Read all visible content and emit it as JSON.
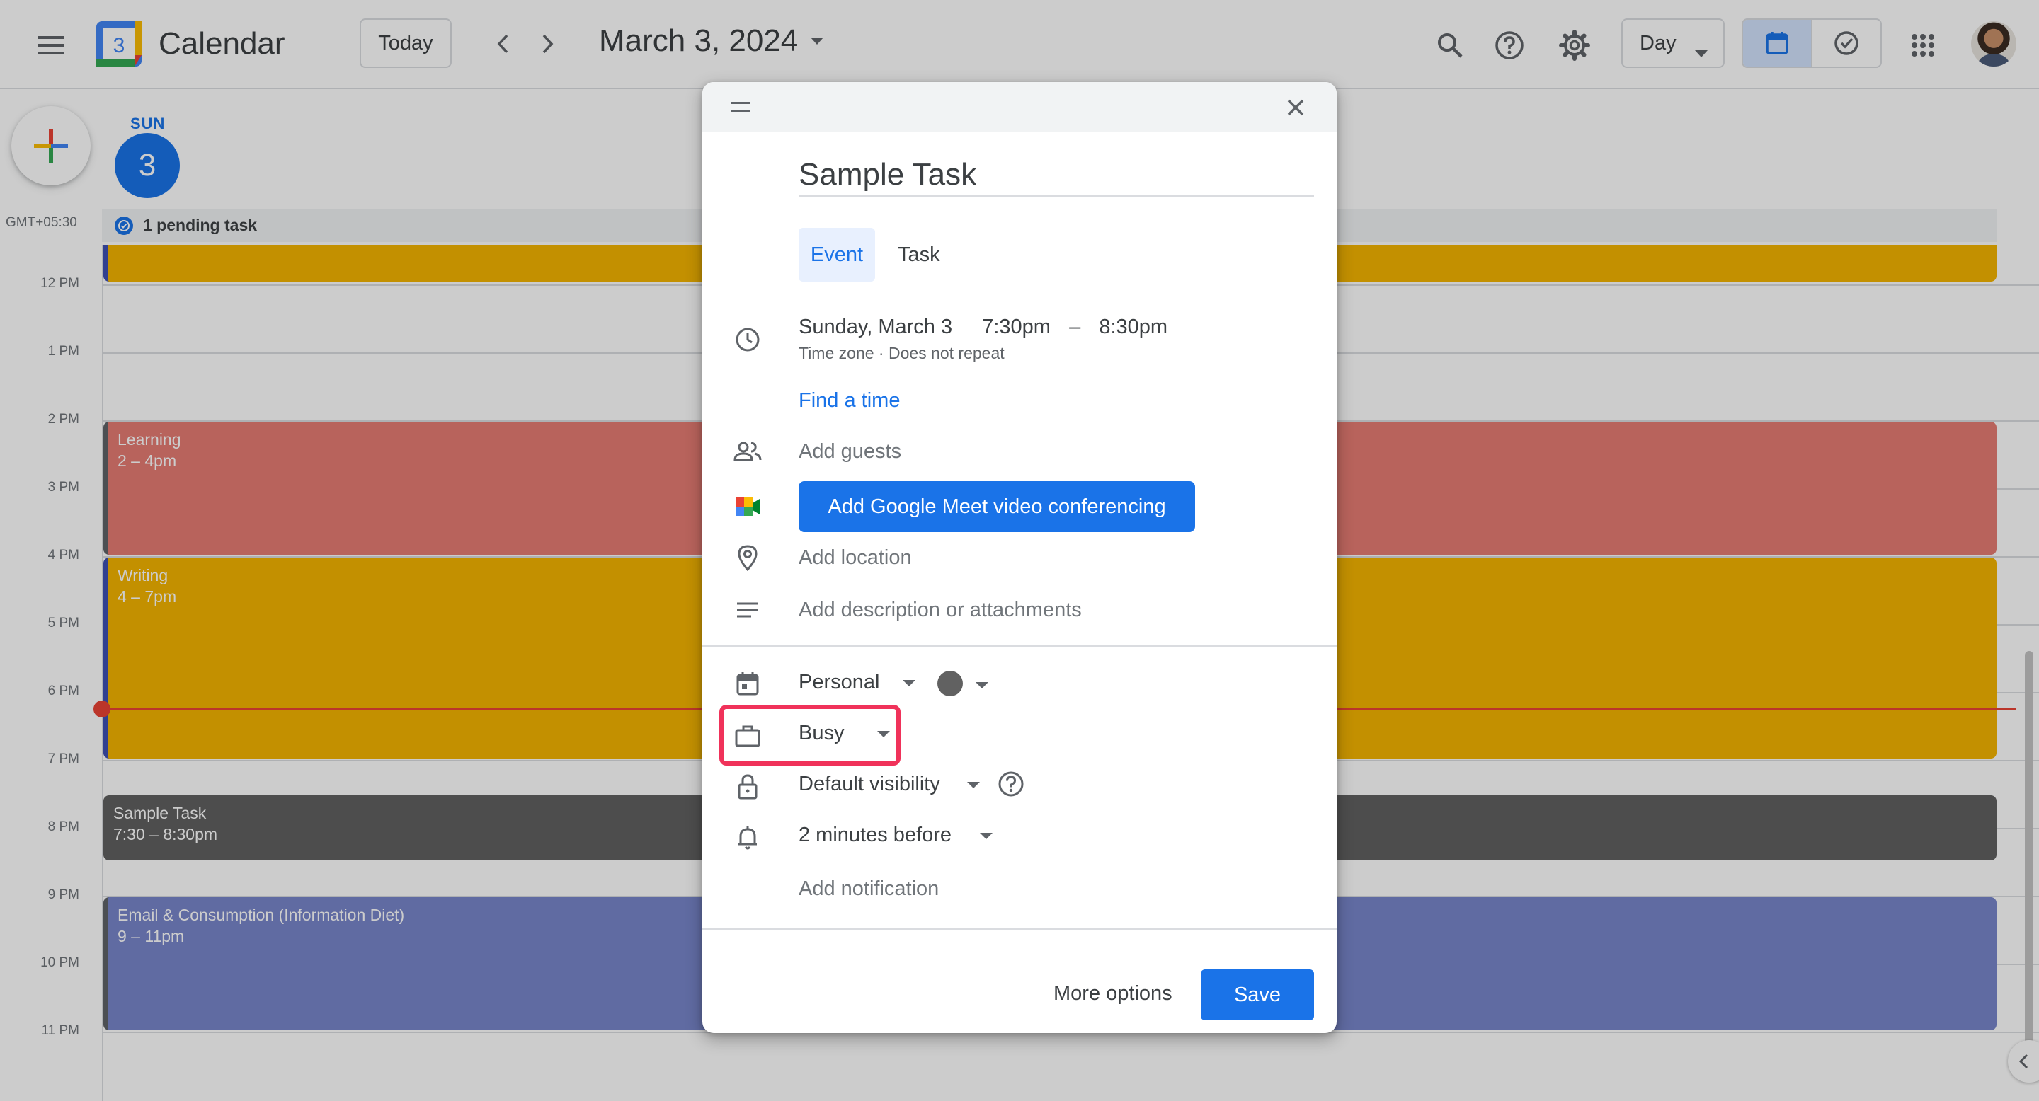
{
  "header": {
    "app_title": "Calendar",
    "logo_number": "3",
    "today_label": "Today",
    "date_label": "March 3, 2024",
    "view_label": "Day",
    "icons": [
      "menu-icon",
      "chevron-left-icon",
      "chevron-right-icon",
      "search-icon",
      "help-icon",
      "settings-icon",
      "calendar-view-icon",
      "tasks-view-icon",
      "apps-icon"
    ]
  },
  "day_header": {
    "day_name": "SUN",
    "day_number": "3",
    "timezone": "GMT+05:30",
    "pending": "1 pending task"
  },
  "hours": [
    "12 PM",
    "1 PM",
    "2 PM",
    "3 PM",
    "4 PM",
    "5 PM",
    "6 PM",
    "7 PM",
    "8 PM",
    "9 PM",
    "10 PM",
    "11 PM"
  ],
  "events": [
    {
      "title": "Learning",
      "time": "2 – 4pm",
      "color": "#e67c73"
    },
    {
      "title": "Writing",
      "time": "4 – 7pm",
      "color": "#f4b400"
    },
    {
      "title": "Sample Task",
      "time": "7:30 – 8:30pm",
      "color": "#616161"
    },
    {
      "title": "Email & Consumption (Information Diet)",
      "time": "9 – 11pm",
      "color": "#7986cb"
    }
  ],
  "dialog": {
    "title_value": "Sample Task",
    "tabs": [
      "Event",
      "Task"
    ],
    "date": "Sunday, March 3",
    "time_start": "7:30pm",
    "time_sep": "–",
    "time_end": "8:30pm",
    "tz_repeat": "Time zone · Does not repeat",
    "find_time": "Find a time",
    "add_guests": "Add guests",
    "meet_button": "Add Google Meet video conferencing",
    "add_location": "Add location",
    "add_description": "Add description or attachments",
    "calendar_name": "Personal",
    "availability": "Busy",
    "visibility": "Default visibility",
    "notification": "2 minutes before",
    "add_notification": "Add notification",
    "more_options": "More options",
    "save": "Save"
  },
  "colors": {
    "accent": "#1a73e8",
    "highlight": "#f0325a",
    "now_line": "#ea4335"
  }
}
